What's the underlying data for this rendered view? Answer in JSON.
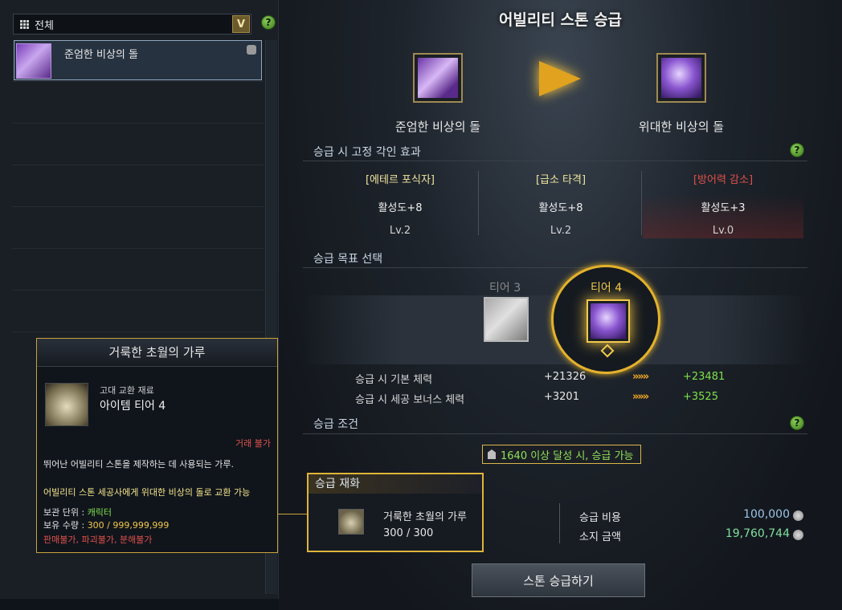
{
  "left_panel": {
    "filter_label": "전체",
    "dropdown_symbol": "V",
    "help_symbol": "?",
    "list": [
      {
        "label": "준엄한 비상의 돌",
        "selected": true,
        "icon": "purple-stone-icon"
      }
    ]
  },
  "main": {
    "title": "어빌리티 스톤 승급",
    "from_stone": "준엄한 비상의 돌",
    "to_stone": "위대한 비상의 돌",
    "engrave_section": {
      "heading": "승급 시 고정 각인 효과",
      "effects": [
        {
          "name": "[에테르 포식자]",
          "value": "활성도+8",
          "level": "Lv.2",
          "color": "#f0e6a0"
        },
        {
          "name": "[급소 타격]",
          "value": "활성도+8",
          "level": "Lv.2",
          "color": "#f0e6a0"
        },
        {
          "name": "[방어력 감소]",
          "value": "활성도+3",
          "level": "Lv.0",
          "color": "#e0504a"
        }
      ]
    },
    "target_section": {
      "heading": "승급 목표 선택",
      "tier3_label": "티어 3",
      "tier4_label": "티어 4"
    },
    "stats": [
      {
        "label": "승급 시 기본 체력",
        "current": "+21326",
        "arrows": "»»»",
        "next": "+23481"
      },
      {
        "label": "승급 시 세공 보너스 체력",
        "current": "+3201",
        "arrows": "»»»",
        "next": "+3525"
      }
    ],
    "condition_section": {
      "heading": "승급 조건",
      "condition_text": "1640 이상 달성 시, 승급 가능"
    },
    "material": {
      "heading": "승급 재화",
      "name": "거룩한 초월의 가루",
      "count": "300 / 300"
    },
    "cost": {
      "cost_label": "승급 비용",
      "cost_value": "100,000",
      "owned_label": "소지 금액",
      "owned_value": "19,760,744"
    },
    "upgrade_button": "스톤 승급하기"
  },
  "tooltip": {
    "title": "거룩한 초월의 가루",
    "subtitle": "고대 교환 재료",
    "tier": "아이템 티어 4",
    "trade": "거래 불가",
    "description": "뛰어난 어빌리티 스톤을 제작하는 데 사용되는 가루.",
    "exchange": "어빌리티 스톤 세공사에게 위대한 비상의 돌로 교환 가능",
    "storage_label": "보관 단위 : ",
    "storage_value": "캐릭터",
    "owned_label": "보유 수량 : ",
    "owned_value": "300",
    "owned_max": " / 999,999,999",
    "flags": "판매불가, 파괴불가, 분해불가"
  },
  "colors": {
    "accent_gold": "#e3b12c",
    "positive_green": "#7fe04a",
    "negative_red": "#e0504a"
  }
}
